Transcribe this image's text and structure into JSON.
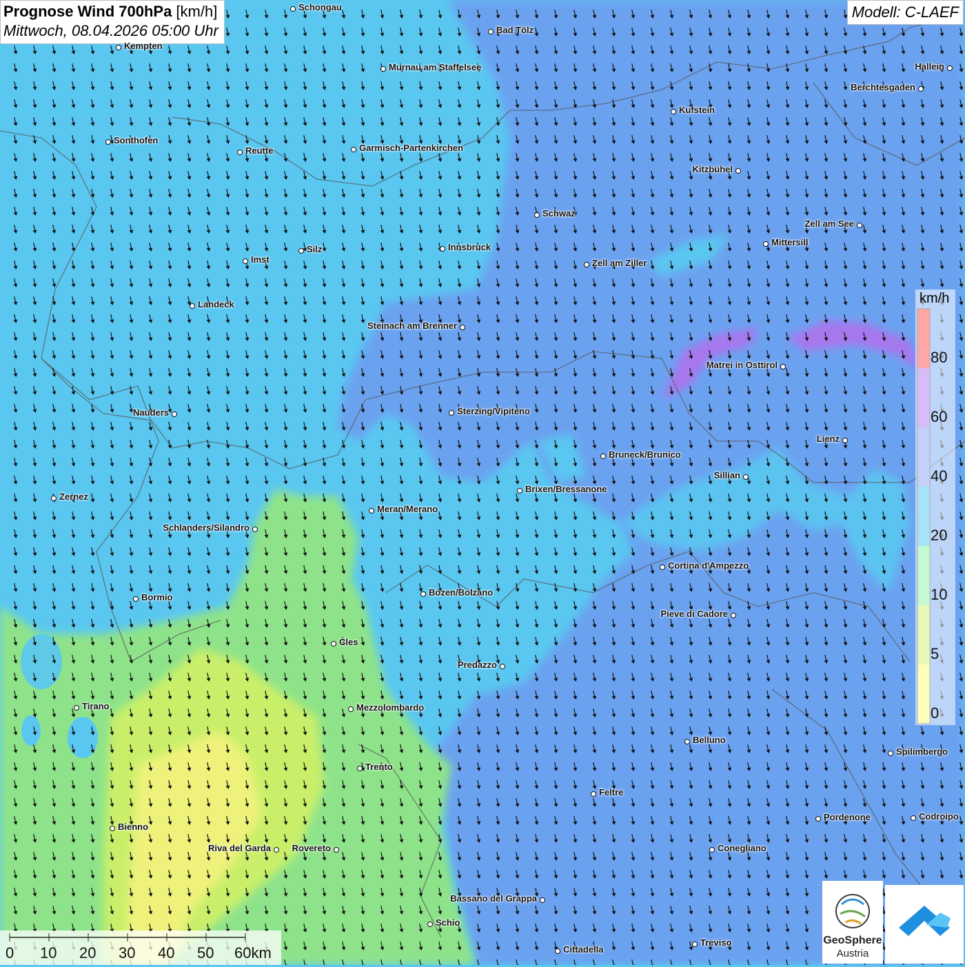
{
  "header": {
    "title_bold": "Prognose Wind 700hPa",
    "title_unit": " [km/h]",
    "subtitle": "Mittwoch, 08.04.2026 05:00 Uhr"
  },
  "model": {
    "label": "Modell: C-LAEF"
  },
  "legend": {
    "unit": "km/h",
    "labels": [
      "80",
      "60",
      "40",
      "20",
      "10",
      "5",
      "0"
    ],
    "colors": [
      "#ff3a3a",
      "#a96cf0",
      "#7a9af2",
      "#3cbfec",
      "#7ef29a",
      "#c8f25e",
      "#fafa6e"
    ]
  },
  "cities": [
    "Schongau",
    "Bad Tölz",
    "Kempten",
    "Murnau am Staffelsee",
    "Hallein",
    "Berchtesgaden",
    "Kufstein",
    "Sonthofen",
    "Reutte",
    "Garmisch-Partenkirchen",
    "Kitzbühel",
    "Schwaz",
    "Zell am See",
    "Mittersill",
    "Innsbruck",
    "Silz",
    "Imst",
    "Zell am Ziller",
    "Landeck",
    "Steinach am Brenner",
    "Matrei in Osttirol",
    "Nauders",
    "Sterzing/Vipiteno",
    "Lienz",
    "Bruneck/Brunico",
    "Sillian",
    "Brixen/Bressanone",
    "Zernez",
    "Meran/Merano",
    "Schlanders/Silandro",
    "Cortina d'Ampezzo",
    "Bozen/Bolzano",
    "Bormio",
    "Pieve di Cadore",
    "Cles",
    "Predazzo",
    "Tirano",
    "Mezzolombardo",
    "Belluno",
    "Spilimbergo",
    "Trento",
    "Feltre",
    "Pordenone",
    "Codroipo",
    "Bienno",
    "Riva del Garda",
    "Rovereto",
    "Conegliano",
    "Bassano del Grappa",
    "Schio",
    "Treviso",
    "Cittadella"
  ],
  "scale": {
    "labels": [
      "0",
      "10",
      "20",
      "30",
      "40",
      "50",
      "60km"
    ]
  },
  "logo": {
    "name": "GeoSphere",
    "sub": "Austria"
  }
}
